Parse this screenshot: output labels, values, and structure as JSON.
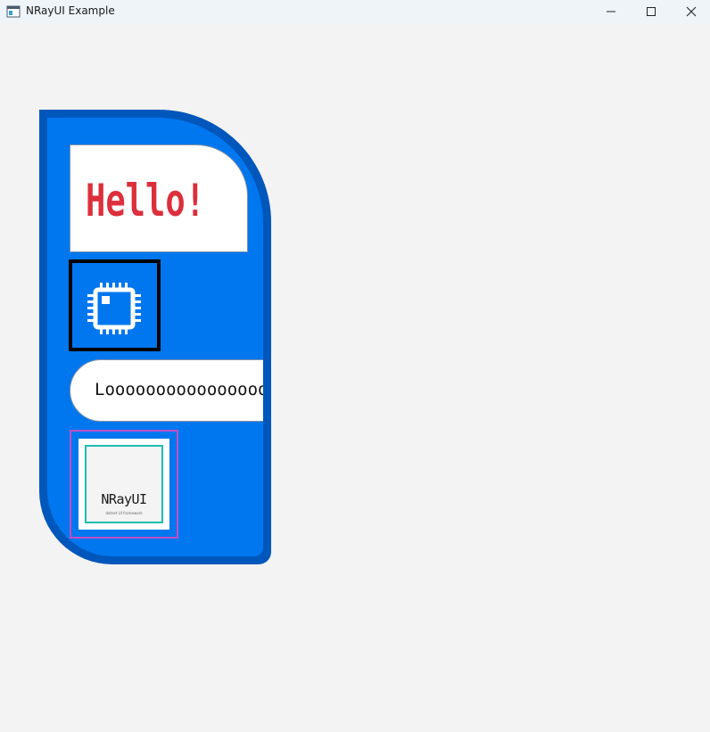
{
  "window": {
    "title": "NRayUI Example",
    "buttons": [
      "minimize",
      "maximize",
      "close"
    ]
  },
  "panel": {
    "colors": {
      "outer": "#0057bb",
      "inner": "#0077ee"
    },
    "hello": {
      "text": "Hello!",
      "color": "#dc2f3c"
    },
    "chip": {
      "icon": "cpu-chip-icon",
      "color": "#ffffff"
    },
    "long_label": "Looooooooooooooooo",
    "logo": {
      "word": "NRayUI",
      "tagline": "dotnet UI framework",
      "accent": "#1dbdb0"
    }
  }
}
